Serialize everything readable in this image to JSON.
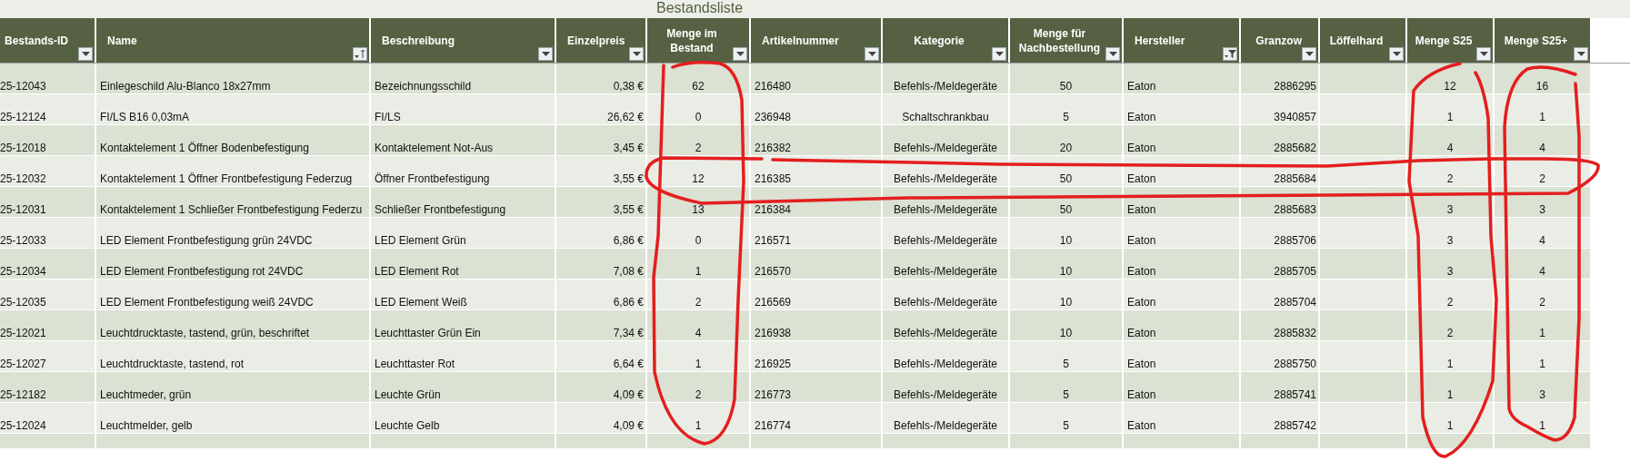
{
  "title": "Bestandsliste",
  "columns": [
    {
      "label": "Bestands-ID",
      "kind": "dropdown"
    },
    {
      "label": "Name",
      "kind": "sorted"
    },
    {
      "label": "Beschreibung",
      "kind": "dropdown"
    },
    {
      "label": "Einzelpreis",
      "kind": "dropdown"
    },
    {
      "label": "Menge im Bestand",
      "kind": "dropdown"
    },
    {
      "label": "Artikelnummer",
      "kind": "dropdown"
    },
    {
      "label": "Kategorie",
      "kind": "dropdown"
    },
    {
      "label": "Menge für Nachbestellung",
      "kind": "dropdown"
    },
    {
      "label": "Hersteller",
      "kind": "filtered"
    },
    {
      "label": "Granzow",
      "kind": "dropdown"
    },
    {
      "label": "Löffelhard",
      "kind": "dropdown"
    },
    {
      "label": "Menge S25",
      "kind": "dropdown"
    },
    {
      "label": "Menge S25+",
      "kind": "dropdown"
    }
  ],
  "rows": [
    {
      "id": "25-12043",
      "name": "Einlegeschild Alu-Blanco 18x27mm",
      "beschreibung": "Bezeichnungsschild",
      "preis": "0,38 €",
      "bestand": "62",
      "artikel": "216480",
      "kategorie": "Befehls-/Meldegeräte",
      "nachbestellung": "50",
      "hersteller": "Eaton",
      "granzow": "2886295",
      "s25": "12",
      "s25plus": "16"
    },
    {
      "id": "25-12124",
      "name": "FI/LS B16 0,03mA",
      "beschreibung": "FI/LS",
      "preis": "26,62 €",
      "bestand": "0",
      "artikel": "236948",
      "kategorie": "Schaltschrankbau",
      "nachbestellung": "5",
      "hersteller": "Eaton",
      "granzow": "3940857",
      "s25": "1",
      "s25plus": "1"
    },
    {
      "id": "25-12018",
      "name": "Kontaktelement 1 Öffner Bodenbefestigung",
      "beschreibung": "Kontaktelement Not-Aus",
      "preis": "3,45 €",
      "bestand": "2",
      "artikel": "216382",
      "kategorie": "Befehls-/Meldegeräte",
      "nachbestellung": "20",
      "hersteller": "Eaton",
      "granzow": "2885682",
      "s25": "4",
      "s25plus": "4"
    },
    {
      "id": "25-12032",
      "name": "Kontaktelement 1 Öffner Frontbefestigung Federzug",
      "beschreibung": "Öffner Frontbefestigung",
      "preis": "3,55 €",
      "bestand": "12",
      "artikel": "216385",
      "kategorie": "Befehls-/Meldegeräte",
      "nachbestellung": "50",
      "hersteller": "Eaton",
      "granzow": "2885684",
      "s25": "2",
      "s25plus": "2"
    },
    {
      "id": "25-12031",
      "name": "Kontaktelement 1 Schließer Frontbefestigung Federzu",
      "beschreibung": "Schließer Frontbefestigung",
      "preis": "3,55 €",
      "bestand": "13",
      "artikel": "216384",
      "kategorie": "Befehls-/Meldegeräte",
      "nachbestellung": "50",
      "hersteller": "Eaton",
      "granzow": "2885683",
      "s25": "3",
      "s25plus": "3"
    },
    {
      "id": "25-12033",
      "name": "LED Element Frontbefestigung grün 24VDC",
      "beschreibung": "LED Element Grün",
      "preis": "6,86 €",
      "bestand": "0",
      "artikel": "216571",
      "kategorie": "Befehls-/Meldegeräte",
      "nachbestellung": "10",
      "hersteller": "Eaton",
      "granzow": "2885706",
      "s25": "3",
      "s25plus": "4"
    },
    {
      "id": "25-12034",
      "name": "LED Element Frontbefestigung rot 24VDC",
      "beschreibung": "LED Element Rot",
      "preis": "7,08 €",
      "bestand": "1",
      "artikel": "216570",
      "kategorie": "Befehls-/Meldegeräte",
      "nachbestellung": "10",
      "hersteller": "Eaton",
      "granzow": "2885705",
      "s25": "3",
      "s25plus": "4"
    },
    {
      "id": "25-12035",
      "name": "LED Element Frontbefestigung weiß 24VDC",
      "beschreibung": "LED Element Weiß",
      "preis": "6,86 €",
      "bestand": "2",
      "artikel": "216569",
      "kategorie": "Befehls-/Meldegeräte",
      "nachbestellung": "10",
      "hersteller": "Eaton",
      "granzow": "2885704",
      "s25": "2",
      "s25plus": "2"
    },
    {
      "id": "25-12021",
      "name": "Leuchtdrucktaste, tastend, grün, beschriftet",
      "beschreibung": "Leuchttaster Grün Ein",
      "preis": "7,34 €",
      "bestand": "4",
      "artikel": "216938",
      "kategorie": "Befehls-/Meldegeräte",
      "nachbestellung": "10",
      "hersteller": "Eaton",
      "granzow": "2885832",
      "s25": "2",
      "s25plus": "1"
    },
    {
      "id": "25-12027",
      "name": "Leuchtdrucktaste, tastend, rot",
      "beschreibung": "Leuchttaster Rot",
      "preis": "6,64 €",
      "bestand": "1",
      "artikel": "216925",
      "kategorie": "Befehls-/Meldegeräte",
      "nachbestellung": "5",
      "hersteller": "Eaton",
      "granzow": "2885750",
      "s25": "1",
      "s25plus": "1"
    },
    {
      "id": "25-12182",
      "name": "Leuchtmeder, grün",
      "beschreibung": "Leuchte Grün",
      "preis": "4,09 €",
      "bestand": "2",
      "artikel": "216773",
      "kategorie": "Befehls-/Meldegeräte",
      "nachbestellung": "5",
      "hersteller": "Eaton",
      "granzow": "2885741",
      "s25": "1",
      "s25plus": "3"
    },
    {
      "id": "25-12024",
      "name": "Leuchtmelder, gelb",
      "beschreibung": "Leuchte Gelb",
      "preis": "4,09 €",
      "bestand": "1",
      "artikel": "216774",
      "kategorie": "Befehls-/Meldegeräte",
      "nachbestellung": "5",
      "hersteller": "Eaton",
      "granzow": "2885742",
      "s25": "1",
      "s25plus": "1"
    }
  ]
}
